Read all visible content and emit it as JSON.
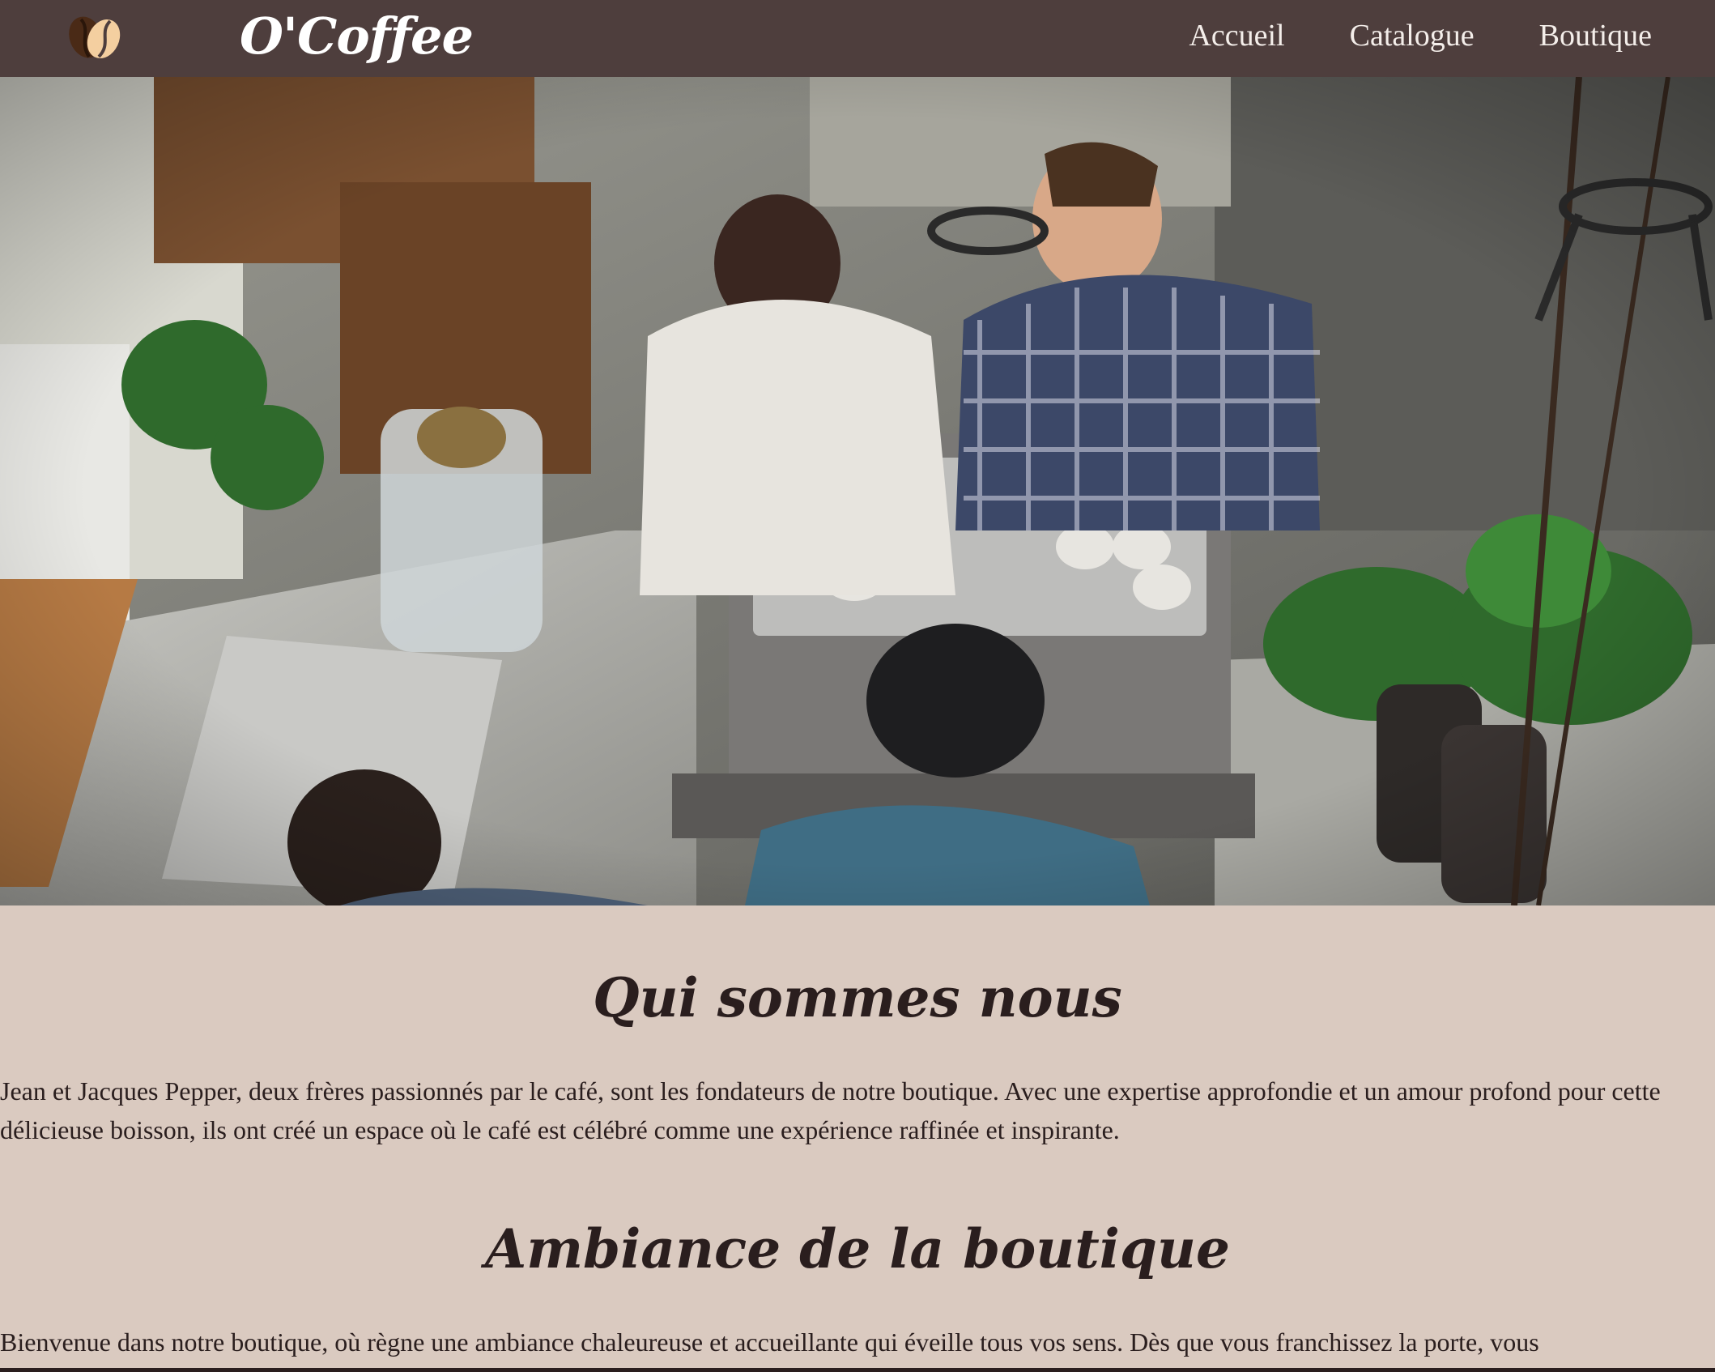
{
  "header": {
    "brand": "O'Coffee",
    "nav": [
      {
        "label": "Accueil"
      },
      {
        "label": "Catalogue"
      },
      {
        "label": "Boutique"
      }
    ]
  },
  "hero": {
    "image_alt": "coffee-shop-overhead-photo"
  },
  "about": {
    "title": "Qui sommes nous",
    "text": "Jean et Jacques Pepper, deux frères passionnés par le café, sont les fondateurs de notre boutique. Avec une expertise approfondie et un amour profond pour cette délicieuse boisson, ils ont créé un espace où le café est célébré comme une expérience raffinée et inspirante."
  },
  "ambiance": {
    "title": "Ambiance de la boutique",
    "text": "Bienvenue dans notre boutique, où règne une ambiance chaleureuse et accueillante qui éveille tous vos sens. Dès que vous franchissez la porte, vous"
  },
  "colors": {
    "header_bg": "#4e3e3d",
    "page_bg": "#dacac0",
    "text": "#2a1e1e",
    "bean_dark": "#4a2a16",
    "bean_light": "#f4cfa0"
  }
}
